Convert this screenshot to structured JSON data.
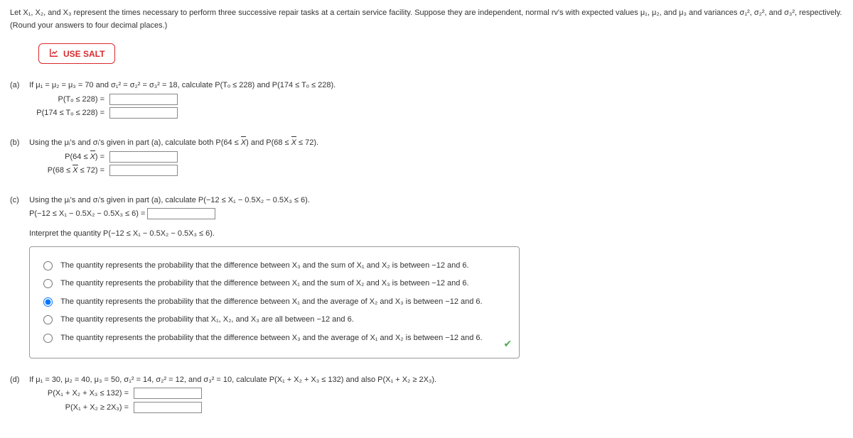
{
  "intro": "Let X₁, X₂, and X₃ represent the times necessary to perform three successive repair tasks at a certain service facility. Suppose they are independent, normal rv's with expected values μ₁, μ₂, and μ₃ and variances σ₁², σ₂², and σ₃², respectively. (Round your answers to four decimal places.)",
  "salt_label": "USE SALT",
  "a": {
    "label": "(a)",
    "stem": "If μ₁ = μ₂ = μ₃ = 70 and σ₁² = σ₂² = σ₃² = 18, calculate P(Tₒ ≤ 228) and P(174 ≤ Tₒ ≤ 228).",
    "eq1_label": "P(Tₒ ≤ 228)  =",
    "eq2_label": "P(174 ≤ Tₒ ≤ 228)  ="
  },
  "b": {
    "label": "(b)",
    "stem_pre": "Using the μᵢ's and σᵢ's given in part (a), calculate both P(64 ≤ ",
    "stem_mid": ") and P(68 ≤ ",
    "stem_post": " ≤ 72).",
    "eq1_pre": "P(64 ≤ ",
    "eq1_post": ")  =",
    "eq2_pre": "P(68 ≤ ",
    "eq2_post": " ≤ 72)  ="
  },
  "c": {
    "label": "(c)",
    "stem": "Using the μᵢ's and σᵢ's given in part (a), calculate P(−12 ≤ X₁ − 0.5X₂ − 0.5X₃ ≤ 6).",
    "eq_label": "P(−12 ≤ X₁ − 0.5X₂ − 0.5X₃ ≤ 6) =",
    "interpret": "Interpret the quantity P(−12 ≤ X₁ − 0.5X₂ − 0.5X₃ ≤ 6).",
    "opts": [
      "The quantity represents the probability that the difference between X₃ and the sum of X₁ and X₂ is between −12 and 6.",
      "The quantity represents the probability that the difference between X₁ and the sum of X₂ and X₃ is between −12 and 6.",
      "The quantity represents the probability that the difference between X₁ and the average of X₂ and X₃ is between −12 and 6.",
      "The quantity represents the probability that X₁, X₂, and X₃ are all between −12 and 6.",
      "The quantity represents the probability that the difference between X₃ and the average of X₁ and X₂ is between −12 and 6."
    ],
    "selected": 2
  },
  "d": {
    "label": "(d)",
    "stem": "If μ₁ = 30, μ₂ = 40, μ₃ = 50, σ₁² = 14, σ₂² = 12, and σ₃² = 10, calculate P(X₁ + X₂ + X₃ ≤ 132) and also P(X₁ + X₂ ≥ 2X₃).",
    "eq1_label": "P(X₁ + X₂ + X₃ ≤ 132)  =",
    "eq2_label": "P(X₁ + X₂ ≥ 2X₃)  ="
  }
}
